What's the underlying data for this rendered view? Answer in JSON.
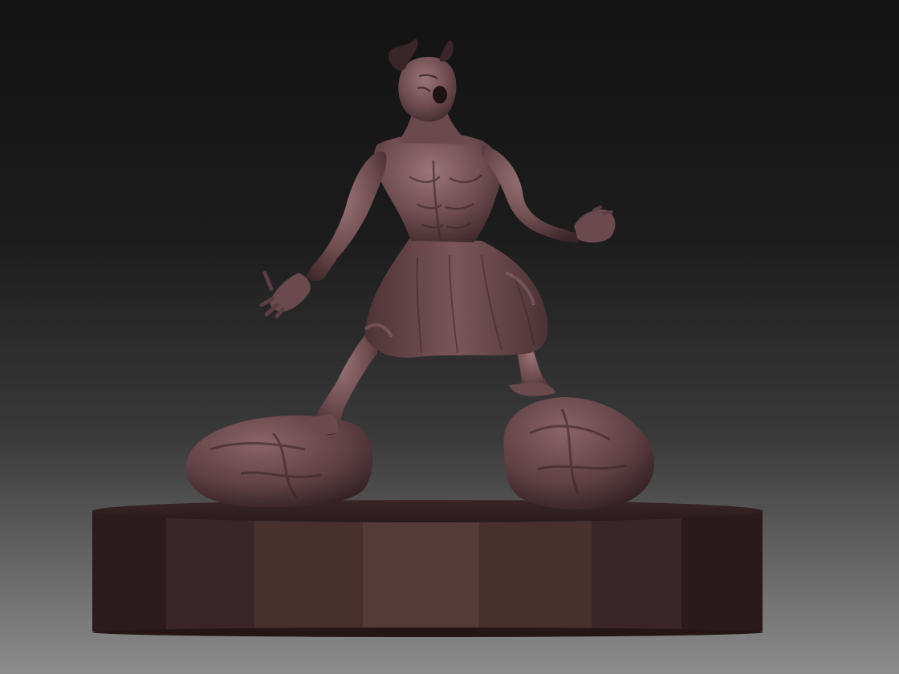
{
  "viewport": {
    "background_top": "#151515",
    "background_bottom": "#8a8a8a"
  },
  "model": {
    "subject": "horned-demon-sculpt",
    "material_color": "#6e4c4f",
    "material_shadow": "#2d1c1e",
    "material_highlight": "#9a7275"
  }
}
